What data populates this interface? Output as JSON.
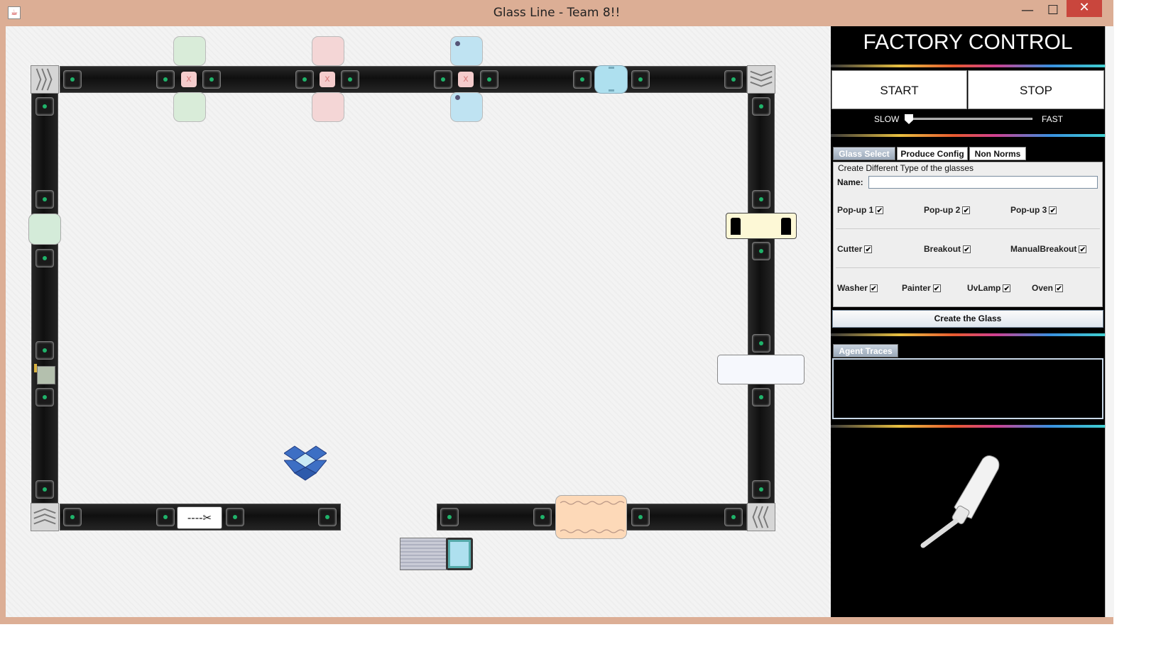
{
  "window": {
    "title": "Glass Line - Team 8!!",
    "app_icon": "java-icon",
    "controls": {
      "minimize": "—",
      "maximize": "☐",
      "close": "✕"
    }
  },
  "factory": {
    "cutter_symbol": "----✂",
    "popup_mark": "x"
  },
  "panel": {
    "title": "FACTORY CONTROL",
    "start_label": "START",
    "stop_label": "STOP",
    "speed": {
      "slow_label": "SLOW",
      "fast_label": "FAST",
      "value": 0
    },
    "tabs": [
      {
        "label": "Glass Select",
        "active": true
      },
      {
        "label": "Produce Config",
        "active": false
      },
      {
        "label": "Non Norms",
        "active": false
      }
    ],
    "form": {
      "legend": "Create Different Type of the glasses",
      "name_label": "Name:",
      "name_value": "",
      "options": [
        {
          "label": "Pop-up 1",
          "checked": true
        },
        {
          "label": "Pop-up 2",
          "checked": true
        },
        {
          "label": "Pop-up 3",
          "checked": true
        },
        {
          "label": "Cutter",
          "checked": true
        },
        {
          "label": "Breakout",
          "checked": true
        },
        {
          "label": "ManualBreakout",
          "checked": true
        },
        {
          "label": "Washer",
          "checked": true
        },
        {
          "label": "Painter",
          "checked": true
        },
        {
          "label": "UvLamp",
          "checked": true
        },
        {
          "label": "Oven",
          "checked": true
        }
      ],
      "check_mark": "✔",
      "create_label": "Create the Glass"
    },
    "traces_tab": "Agent Traces"
  }
}
